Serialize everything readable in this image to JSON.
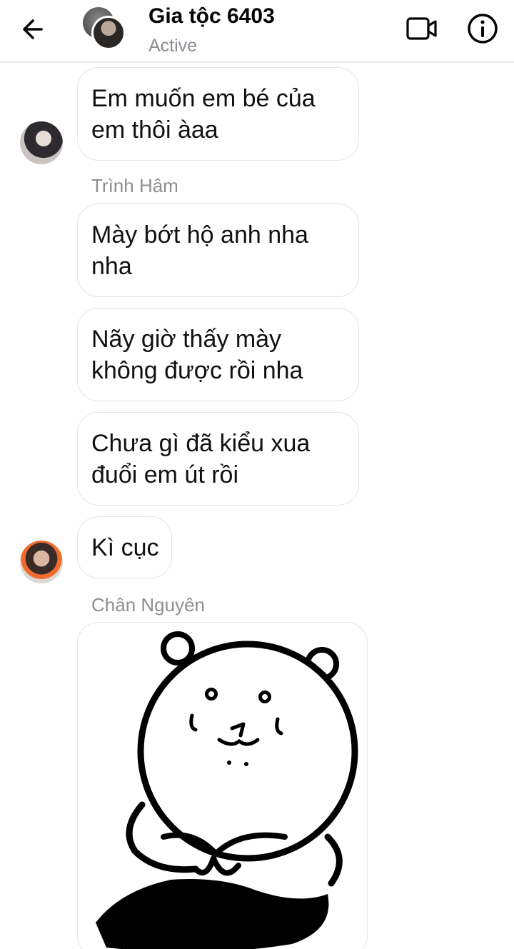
{
  "header": {
    "title": "Gia tộc 6403",
    "status": "Active"
  },
  "messages": [
    {
      "text_line1": "Em muốn em bé của",
      "text_line2": "em thôi àaa"
    },
    {
      "sender": "Trình Hâm",
      "text_line1": "Mày bớt hộ anh nha",
      "text_line2": "nha"
    },
    {
      "text_line1": "Nãy giờ thấy mày",
      "text_line2": "không được rồi nha"
    },
    {
      "text_line1": "Chưa gì đã kiểu xua",
      "text_line2": "đuổi em út rồi"
    },
    {
      "text": "Kì cục"
    },
    {
      "sender": "Chân Nguyên"
    }
  ],
  "icons": {
    "back": "arrow-left-icon",
    "video": "video-camera-icon",
    "info": "info-icon",
    "sticker": "bear-sticker"
  },
  "colors": {
    "secondary_text": "#8a8d91",
    "bubble_border": "#e6e6e6"
  }
}
